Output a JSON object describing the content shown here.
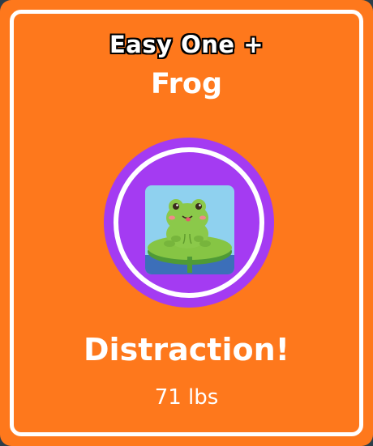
{
  "card": {
    "subtitle": "Easy One +",
    "title": "Frog",
    "caption": "Distraction!",
    "weight": "71 lbs",
    "icon": "frog-on-lily-pad-icon"
  },
  "colors": {
    "card_background": "#fe781c",
    "medal_purple": "#a43bf2",
    "border_white": "#ffffff"
  }
}
